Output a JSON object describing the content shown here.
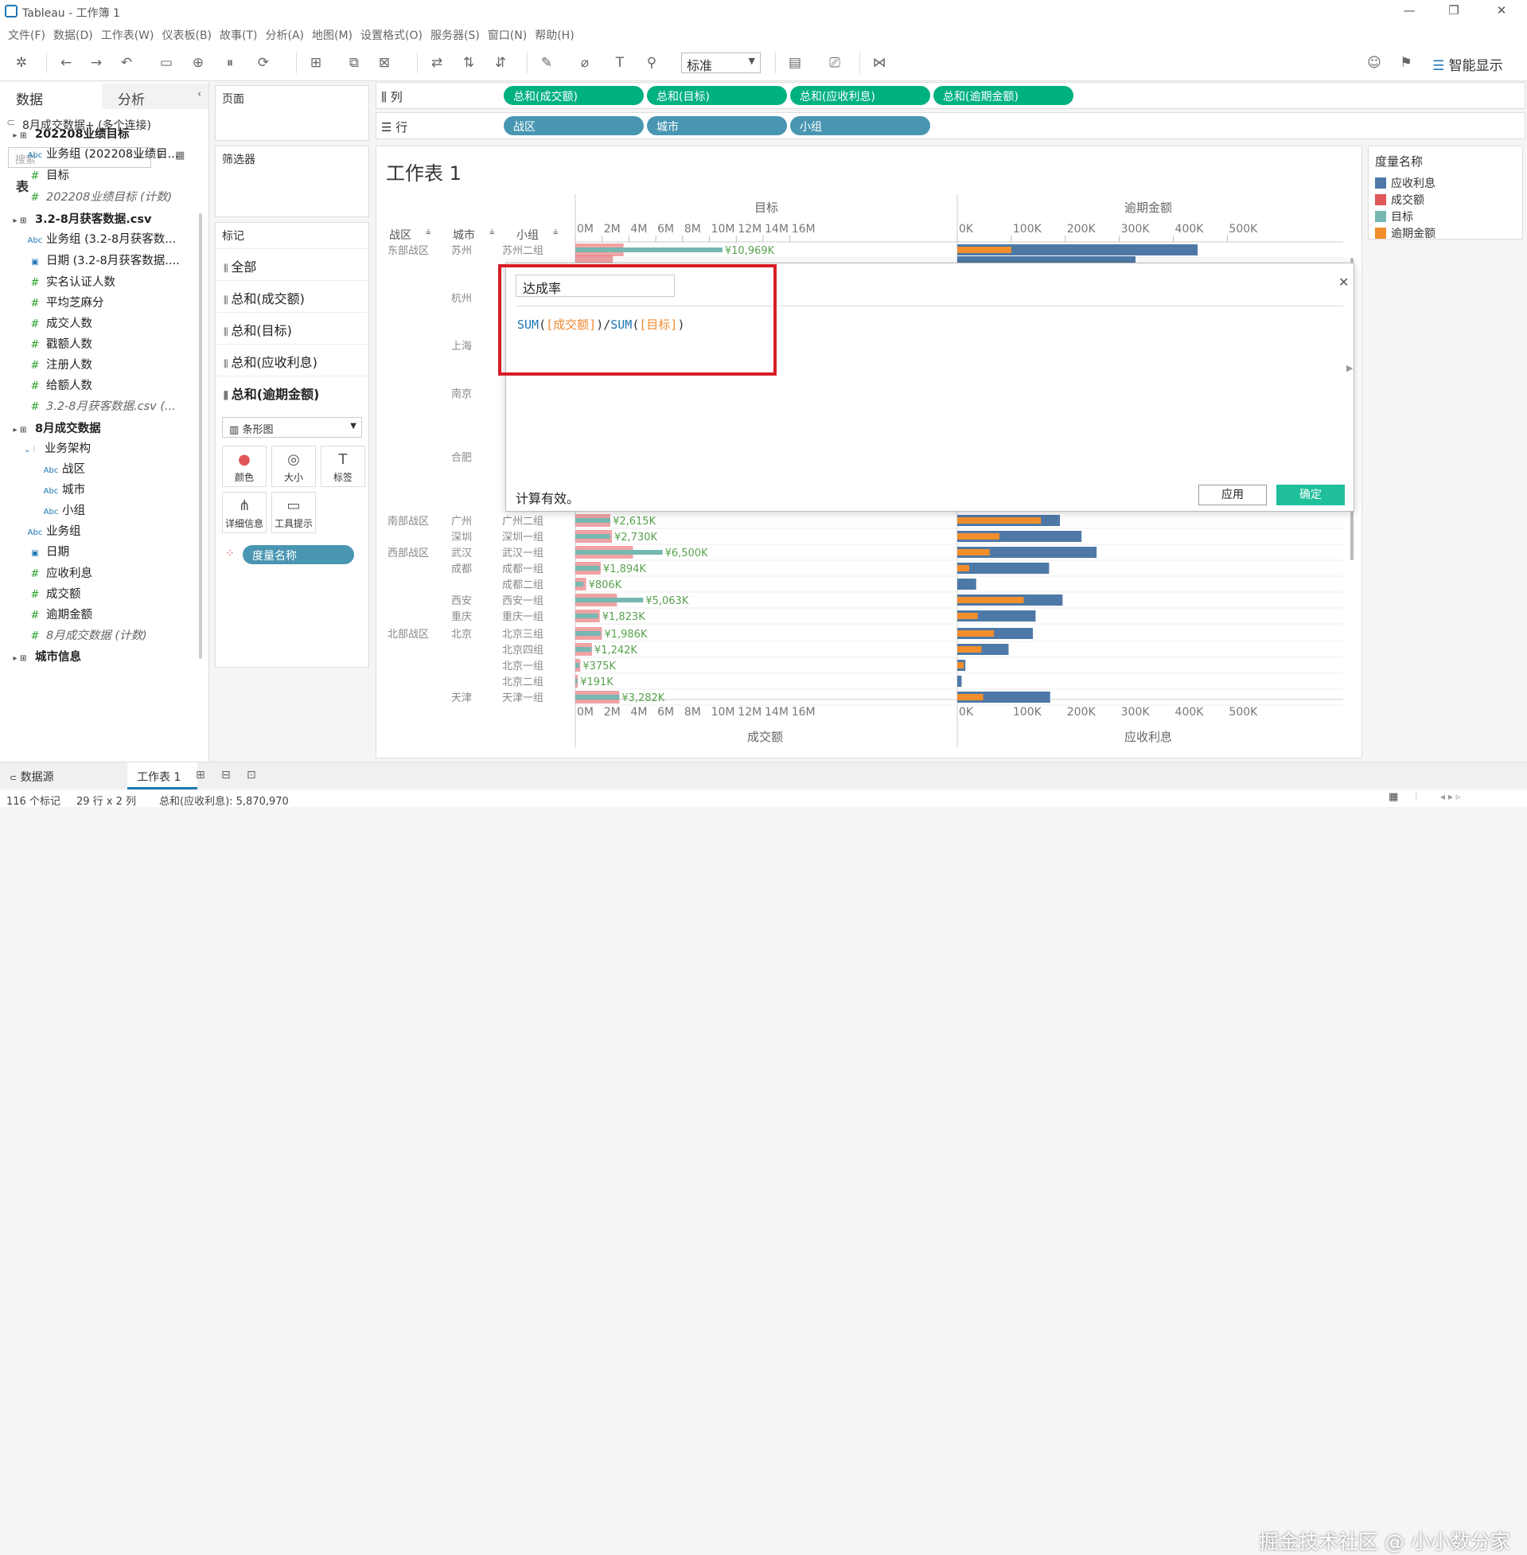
{
  "app": {
    "title": "Tableau - 工作簿 1"
  },
  "menu": [
    "文件(F)",
    "数据(D)",
    "工作表(W)",
    "仪表板(B)",
    "故事(T)",
    "分析(A)",
    "地图(M)",
    "设置格式(O)",
    "服务器(S)",
    "窗口(N)",
    "帮助(H)"
  ],
  "toolbar": {
    "fit_select": "标准",
    "smart_show": "智能显示"
  },
  "left_panel": {
    "tabs": [
      "数据",
      "分析"
    ],
    "connection": "8月成交数据+ (多个连接)",
    "search_placeholder": "搜索",
    "section_title": "表",
    "items": [
      {
        "label": "202208业绩目标",
        "kind": "table",
        "bold": true
      },
      {
        "label": "业务组 (202208业绩目...",
        "kind": "abc"
      },
      {
        "label": "目标",
        "kind": "measure"
      },
      {
        "label": "202208业绩目标 (计数)",
        "kind": "measure",
        "italic": true
      },
      {
        "label": "3.2-8月获客数据.csv",
        "kind": "table",
        "bold": true
      },
      {
        "label": "业务组 (3.2-8月获客数...",
        "kind": "abc"
      },
      {
        "label": "日期 (3.2-8月获客数据....",
        "kind": "date"
      },
      {
        "label": "实名认证人数",
        "kind": "measure"
      },
      {
        "label": "平均芝麻分",
        "kind": "measure"
      },
      {
        "label": "成交人数",
        "kind": "measure"
      },
      {
        "label": "戳额人数",
        "kind": "measure"
      },
      {
        "label": "注册人数",
        "kind": "measure"
      },
      {
        "label": "给额人数",
        "kind": "measure"
      },
      {
        "label": "3.2-8月获客数据.csv (...",
        "kind": "measure",
        "italic": true
      },
      {
        "label": "8月成交数据",
        "kind": "table",
        "bold": true
      },
      {
        "label": "业务架构",
        "kind": "hierarchy"
      },
      {
        "label": "战区",
        "kind": "abc",
        "indent": 2
      },
      {
        "label": "城市",
        "kind": "abc",
        "indent": 2
      },
      {
        "label": "小组",
        "kind": "abc",
        "indent": 2
      },
      {
        "label": "业务组",
        "kind": "abc"
      },
      {
        "label": "日期",
        "kind": "date"
      },
      {
        "label": "应收利息",
        "kind": "measure"
      },
      {
        "label": "成交额",
        "kind": "measure"
      },
      {
        "label": "逾期金额",
        "kind": "measure"
      },
      {
        "label": "8月成交数据 (计数)",
        "kind": "measure",
        "italic": true
      },
      {
        "label": "城市信息",
        "kind": "table",
        "bold": true
      }
    ]
  },
  "mid_panel": {
    "pages": "页面",
    "filters": "筛选器",
    "marks_title": "标记",
    "marks": [
      "全部",
      "总和(成交额)",
      "总和(目标)",
      "总和(应收利息)",
      "总和(逾期金额)"
    ],
    "mark_type": "条形图",
    "buttons": [
      "颜色",
      "大小",
      "标签",
      "详细信息",
      "工具提示"
    ],
    "measure_names_pill": "度量名称"
  },
  "shelves": {
    "columns_label": "列",
    "rows_label": "行",
    "columns": [
      "总和(成交额)",
      "总和(目标)",
      "总和(应收利息)",
      "总和(逾期金额)"
    ],
    "rows": [
      "战区",
      "城市",
      "小组"
    ]
  },
  "view": {
    "sheet_title": "工作表 1",
    "left_axis_title": "目标",
    "right_axis_title": "逾期金额",
    "bottom_left_axis_title": "成交额",
    "bottom_right_axis_title": "应收利息",
    "left_ticks": [
      "0M",
      "2M",
      "4M",
      "6M",
      "8M",
      "10M",
      "12M",
      "14M",
      "16M"
    ],
    "right_ticks": [
      "0K",
      "100K",
      "200K",
      "300K",
      "400K",
      "500K"
    ],
    "row_headers": [
      "战区",
      "城市",
      "小组"
    ]
  },
  "chart_data": {
    "type": "bar",
    "series": [
      {
        "name": "成交额",
        "color": "#e15759"
      },
      {
        "name": "目标",
        "color": "#76b7b2"
      },
      {
        "name": "应收利息",
        "color": "#4e79a7"
      },
      {
        "name": "逾期金额",
        "color": "#f28e2b"
      }
    ],
    "xlim_left_M": [
      0,
      17.5
    ],
    "xlim_right_K": [
      0,
      520
    ],
    "rows": [
      {
        "zone": "东部战区",
        "city": "苏州",
        "group": "苏州二组",
        "sales": 3.6,
        "target": 10.969,
        "label": "¥10,969K",
        "interest": 445,
        "overdue": 100
      },
      {
        "zone": "",
        "city": "",
        "group": "",
        "sales": 2.8,
        "target": 0,
        "label": "",
        "interest": 330,
        "overdue": 0
      },
      {
        "zone": "南部战区",
        "city": "广州",
        "group": "广州二组",
        "sales": 2.615,
        "target": 2.6,
        "label": "¥2,615K",
        "interest": 190,
        "overdue": 155
      },
      {
        "zone": "",
        "city": "深圳",
        "group": "深圳一组",
        "sales": 2.73,
        "target": 2.6,
        "label": "¥2,730K",
        "interest": 230,
        "overdue": 78
      },
      {
        "zone": "西部战区",
        "city": "武汉",
        "group": "武汉一组",
        "sales": 4.3,
        "target": 6.5,
        "label": "¥6,500K",
        "interest": 258,
        "overdue": 60
      },
      {
        "zone": "",
        "city": "成都",
        "group": "成都一组",
        "sales": 1.894,
        "target": 1.8,
        "label": "¥1,894K",
        "interest": 170,
        "overdue": 22
      },
      {
        "zone": "",
        "city": "",
        "group": "成都二组",
        "sales": 0.806,
        "target": 0.6,
        "label": "¥806K",
        "interest": 35,
        "overdue": 0
      },
      {
        "zone": "",
        "city": "西安",
        "group": "西安一组",
        "sales": 3.1,
        "target": 5.063,
        "label": "¥5,063K",
        "interest": 195,
        "overdue": 123
      },
      {
        "zone": "",
        "city": "重庆",
        "group": "重庆一组",
        "sales": 1.823,
        "target": 1.7,
        "label": "¥1,823K",
        "interest": 145,
        "overdue": 38
      },
      {
        "zone": "北部战区",
        "city": "北京",
        "group": "北京三组",
        "sales": 1.986,
        "target": 1.9,
        "label": "¥1,986K",
        "interest": 140,
        "overdue": 68
      },
      {
        "zone": "",
        "city": "",
        "group": "北京四组",
        "sales": 1.242,
        "target": 1.2,
        "label": "¥1,242K",
        "interest": 95,
        "overdue": 45
      },
      {
        "zone": "",
        "city": "",
        "group": "北京一组",
        "sales": 0.375,
        "target": 0.3,
        "label": "¥375K",
        "interest": 15,
        "overdue": 12
      },
      {
        "zone": "",
        "city": "",
        "group": "北京二组",
        "sales": 0.191,
        "target": 0.15,
        "label": "¥191K",
        "interest": 8,
        "overdue": 0
      },
      {
        "zone": "",
        "city": "天津",
        "group": "天津一组",
        "sales": 3.282,
        "target": 3.282,
        "label": "¥3,282K",
        "interest": 172,
        "overdue": 48
      }
    ],
    "hidden_city_labels": [
      "杭州",
      "上海",
      "南京",
      "合肥"
    ]
  },
  "legend": {
    "title": "度量名称",
    "items": [
      {
        "label": "应收利息",
        "color": "#4e79a7"
      },
      {
        "label": "成交额",
        "color": "#e15759"
      },
      {
        "label": "目标",
        "color": "#76b7b2"
      },
      {
        "label": "逾期金额",
        "color": "#f28e2b"
      }
    ]
  },
  "calc_dialog": {
    "name": "达成率",
    "formula_fn1": "SUM",
    "formula_field1": "[成交额]",
    "formula_fn2": "SUM",
    "formula_field2": "[目标]",
    "status": "计算有效。",
    "apply": "应用",
    "ok": "确定"
  },
  "bottom": {
    "datasource_tab": "数据源",
    "sheet_tab": "工作表 1",
    "status_marks": "116 个标记",
    "status_dims": "29 行 x 2 列",
    "status_sum": "总和(应收利息): 5,870,970",
    "watermark": "掘金技术社区 @ 小小数分家"
  }
}
